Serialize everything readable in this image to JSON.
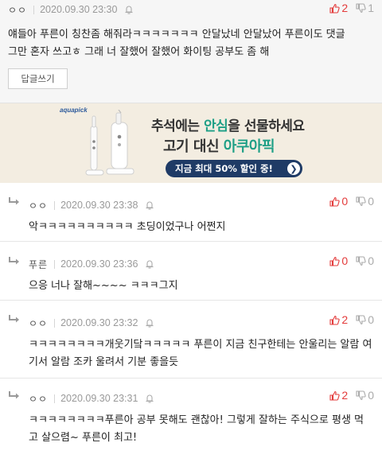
{
  "main_comment": {
    "author": "ㅇㅇ",
    "date": "2020.09.30 23:30",
    "upvotes": "2",
    "downvotes": "1",
    "lines": [
      "얘들아 푸른이 칭찬좀 해줘라ㅋㅋㅋㅋㅋㅋㅋ 안달났네 안달났어 푸른이도 댓글",
      "그만 혼자 쓰고ㅎ 그래 너 잘했어 잘했어 화이팅 공부도 좀 해"
    ],
    "reply_button_label": "답글쓰기"
  },
  "ad": {
    "brand": "aquapick",
    "line1_pre": "추석에는 ",
    "line1_highlight": "안심",
    "line1_post": "을 선물하세요",
    "line2_pre": "고기 대신 ",
    "line2_highlight": "아쿠아픽",
    "pill_text": "지금 최대 50% 할인 중!",
    "pill_arrow": "❯",
    "accent_color": "#1e9f86",
    "pill_color": "#1f3b66"
  },
  "replies": [
    {
      "author": "ㅇㅇ",
      "date": "2020.09.30 23:38",
      "upvotes": "0",
      "downvotes": "0",
      "lines": [
        "악ㅋㅋㅋㅋㅋㅋㅋㅋㅋㅋ 초딩이었구나 어쩐지"
      ]
    },
    {
      "author": "푸른",
      "date": "2020.09.30 23:36",
      "upvotes": "0",
      "downvotes": "0",
      "lines": [
        "으응 너나 잘해~~~~ ㅋㅋㅋ그지"
      ]
    },
    {
      "author": "ㅇㅇ",
      "date": "2020.09.30 23:32",
      "upvotes": "2",
      "downvotes": "0",
      "lines": [
        "ㅋㅋㅋㅋㅋㅋㅋㅋ개웃기닼ㅋㅋㅋㅋㅋ 푸른이 지금 친구한테는 안울리는 알람 여",
        "기서 알람 조카 울려서 기분 좋을듯"
      ]
    },
    {
      "author": "ㅇㅇ",
      "date": "2020.09.30 23:31",
      "upvotes": "2",
      "downvotes": "0",
      "lines": [
        "ㅋㅋㅋㅋㅋㅋㅋㅋ푸른아 공부 못해도 괜찮아! 그렇게 잘하는 주식으로 평생 먹",
        "고 살으렴~ 푸른이 최고!"
      ]
    }
  ],
  "colors": {
    "upvote": "#e33b3b",
    "downvote": "#aaaaaa",
    "main_bg": "#f6f6f6"
  }
}
